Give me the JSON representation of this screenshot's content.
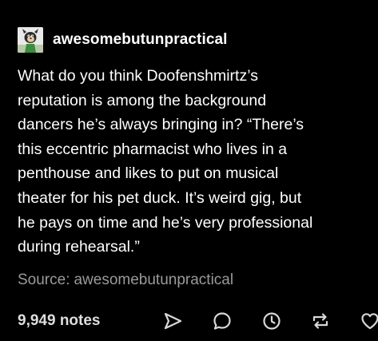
{
  "post": {
    "author": "awesomebutunpractical",
    "avatar_icon": "cartoon-character-avatar",
    "body_lines": [
      "What do you think Doofenshmirtz’s",
      "reputation is among the background",
      "dancers he’s always bringing in?  “There’s",
      "this eccentric pharmacist who lives in a",
      "penthouse and likes to put on musical",
      "theater for his pet duck. It’s weird gig, but",
      "he pays on time and he’s very professional",
      "during rehearsal.”"
    ],
    "source_label": "Source:",
    "source_author": "awesomebutunpractical"
  },
  "footer": {
    "notes": "9,949 notes",
    "actions": [
      {
        "name": "share-button",
        "icon": "share-icon"
      },
      {
        "name": "reply-button",
        "icon": "reply-icon"
      },
      {
        "name": "queue-button",
        "icon": "clock-icon"
      },
      {
        "name": "reblog-button",
        "icon": "reblog-icon"
      },
      {
        "name": "like-button",
        "icon": "heart-icon"
      }
    ]
  },
  "colors": {
    "background": "#000000",
    "text": "#ffffff",
    "muted": "#9a9a9a",
    "icon": "#d8d8d8"
  }
}
